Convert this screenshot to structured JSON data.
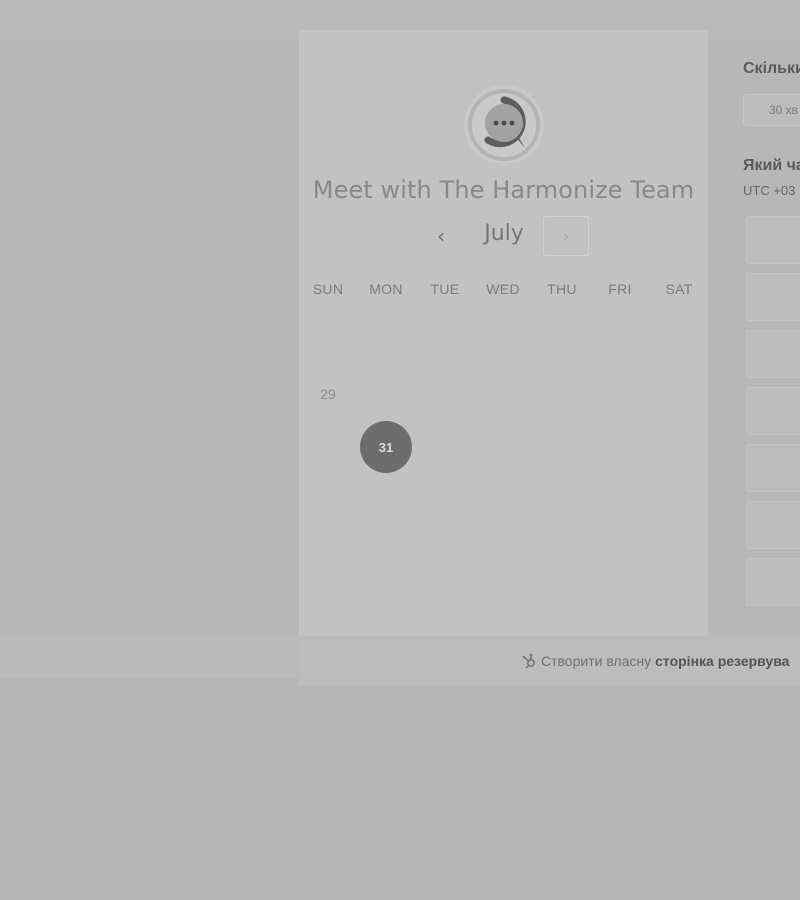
{
  "page": {
    "title": "Meet with The Harmonize Team",
    "logo_icon": "chat-bubble-icon"
  },
  "calendar": {
    "month": "July",
    "prev_label": "‹",
    "next_label": "›",
    "weekdays": [
      "SUN",
      "MON",
      "TUE",
      "WED",
      "THU",
      "FRI",
      "SAT"
    ],
    "days": [
      {
        "label": "29",
        "selected": false
      },
      {
        "label": "31",
        "selected": true
      }
    ]
  },
  "right_panel": {
    "duration_heading": "Скільки",
    "duration_value": "30 хв",
    "time_heading": "Який ча",
    "timezone": "UTC +03"
  },
  "footer": {
    "icon": "hubspot-sprocket-icon",
    "text": "Створити власну",
    "bold_text": "сторінка резервува"
  }
}
